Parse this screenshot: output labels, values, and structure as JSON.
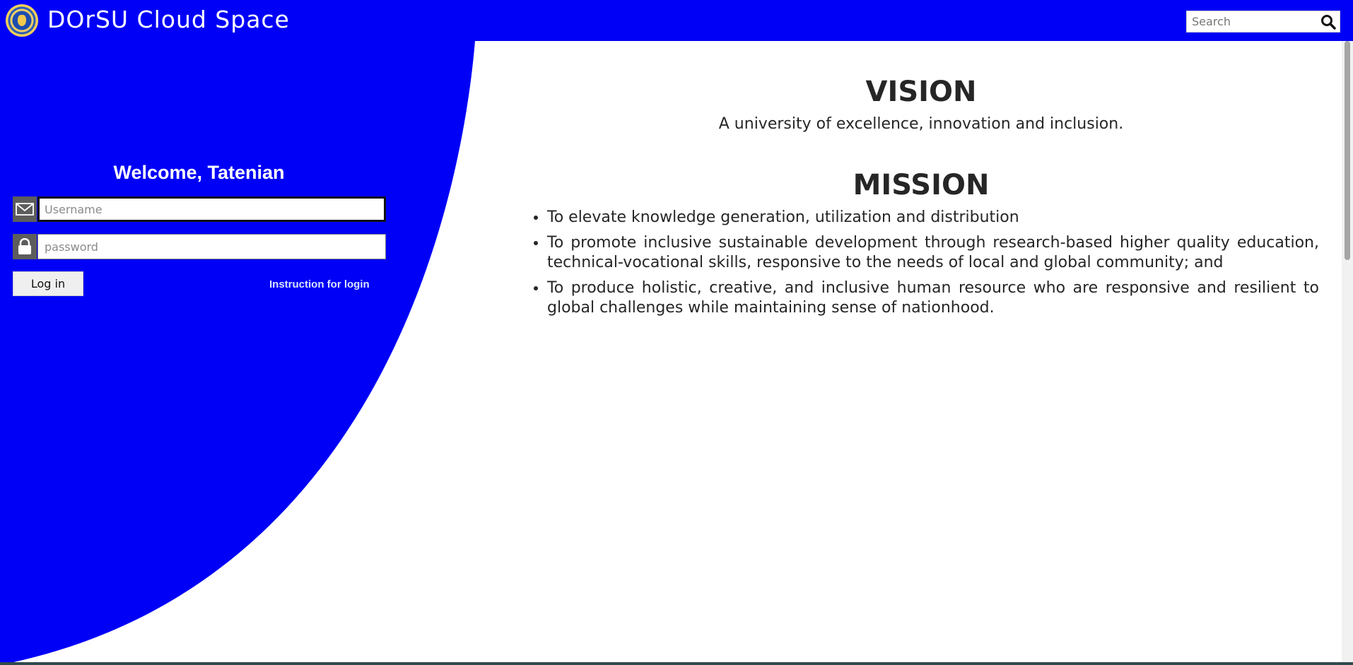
{
  "header": {
    "brand": "DOrSU Cloud Space",
    "search_placeholder": "Search"
  },
  "login": {
    "welcome": "Welcome, Tatenian",
    "username_placeholder": "Username",
    "password_placeholder": "password",
    "login_button": "Log in",
    "instruction_link": "Instruction for login"
  },
  "vision": {
    "title": "VISION",
    "text": "A university of excellence, innovation and inclusion."
  },
  "mission": {
    "title": "MISSION",
    "items": [
      "To elevate knowledge generation, utilization and distribution",
      "To promote inclusive sustainable development through research-based higher quality education, technical-vocational skills, responsive to the needs of local and global community; and",
      "To produce holistic, creative, and inclusive human resource who are responsive and resilient to global challenges while maintaining sense of nationhood."
    ]
  },
  "colors": {
    "brand_blue": "#0000f6",
    "icon_gray": "#5d5d5d"
  },
  "icons": {
    "logo": "university-seal-icon",
    "search": "search-icon",
    "username": "mail-icon",
    "password": "lock-icon"
  }
}
